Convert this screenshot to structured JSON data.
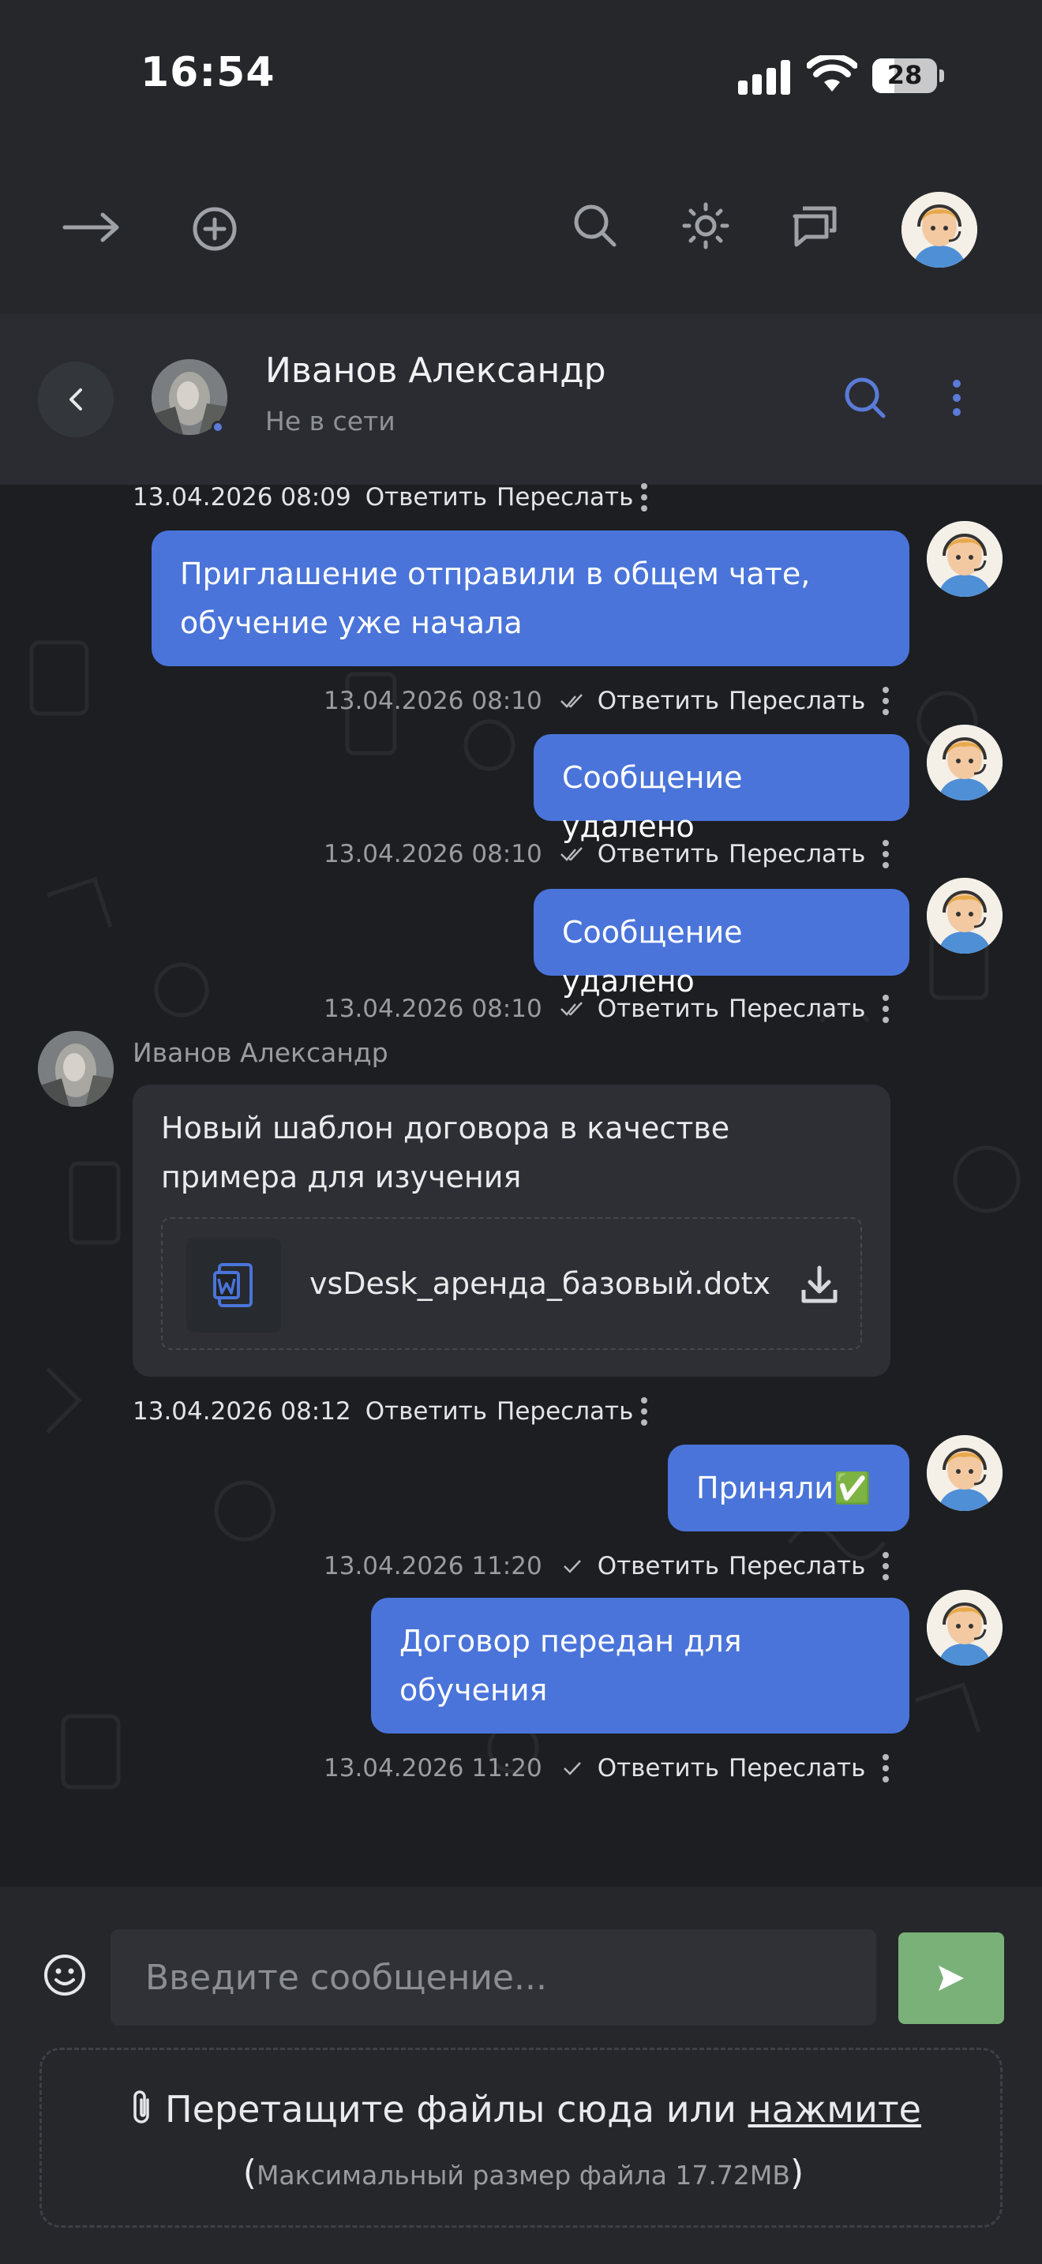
{
  "status_bar": {
    "time": "16:54",
    "battery": "28"
  },
  "toolbar": {
    "icons": [
      "arrow-right-icon",
      "plus-circle-icon",
      "search-icon",
      "brightness-icon",
      "chat-bubbles-icon"
    ]
  },
  "chat_header": {
    "name": "Иванов Александр",
    "status": "Не в сети"
  },
  "messages": [
    {
      "kind": "meta",
      "timestamp": "13.04.2026 08:09",
      "reply": "Ответить",
      "forward": "Переслать"
    },
    {
      "kind": "outgoing",
      "text_line1": "Приглашение отправили в общем чате,",
      "text_line2": "обучение уже начала"
    },
    {
      "kind": "meta",
      "timestamp": "13.04.2026 08:10",
      "reply": "Ответить",
      "forward": "Переслать",
      "read": "double-check"
    },
    {
      "kind": "outgoing",
      "text": "Сообщение удалено"
    },
    {
      "kind": "meta",
      "timestamp": "13.04.2026 08:10",
      "reply": "Ответить",
      "forward": "Переслать",
      "read": "double-check"
    },
    {
      "kind": "outgoing",
      "text": "Сообщение удалено"
    },
    {
      "kind": "meta",
      "timestamp": "13.04.2026 08:10",
      "reply": "Ответить",
      "forward": "Переслать",
      "read": "double-check"
    },
    {
      "kind": "incoming",
      "sender": "Иванов Александр",
      "text_line1": "Новый шаблон договора в качестве",
      "text_line2": "примера для изучения",
      "file_name": "vsDesk_аренда_базовый.dotx"
    },
    {
      "kind": "meta",
      "timestamp": "13.04.2026 08:12",
      "reply": "Ответить",
      "forward": "Переслать"
    },
    {
      "kind": "outgoing",
      "text": "Приняли✅"
    },
    {
      "kind": "meta",
      "timestamp": "13.04.2026 11:20",
      "reply": "Ответить",
      "forward": "Переслать",
      "read": "single-check"
    },
    {
      "kind": "outgoing",
      "text_line1": "Договор передан для",
      "text_line2": "обучения"
    },
    {
      "kind": "meta",
      "timestamp": "13.04.2026 11:20",
      "reply": "Ответить",
      "forward": "Переслать",
      "read": "single-check"
    }
  ],
  "composer": {
    "placeholder": "Введите сообщение...",
    "drop_text": "Перетащите файлы сюда или ",
    "drop_link": "нажмите",
    "max_size": "Максимальный размер файла 17.72MB",
    "paren_open": "(",
    "paren_close": ")"
  },
  "colors": {
    "outgoing_bubble": "#4a74d9",
    "incoming_bubble": "#2d2f34",
    "send_button": "#7ab178",
    "accent_icon": "#5a7bd8"
  }
}
